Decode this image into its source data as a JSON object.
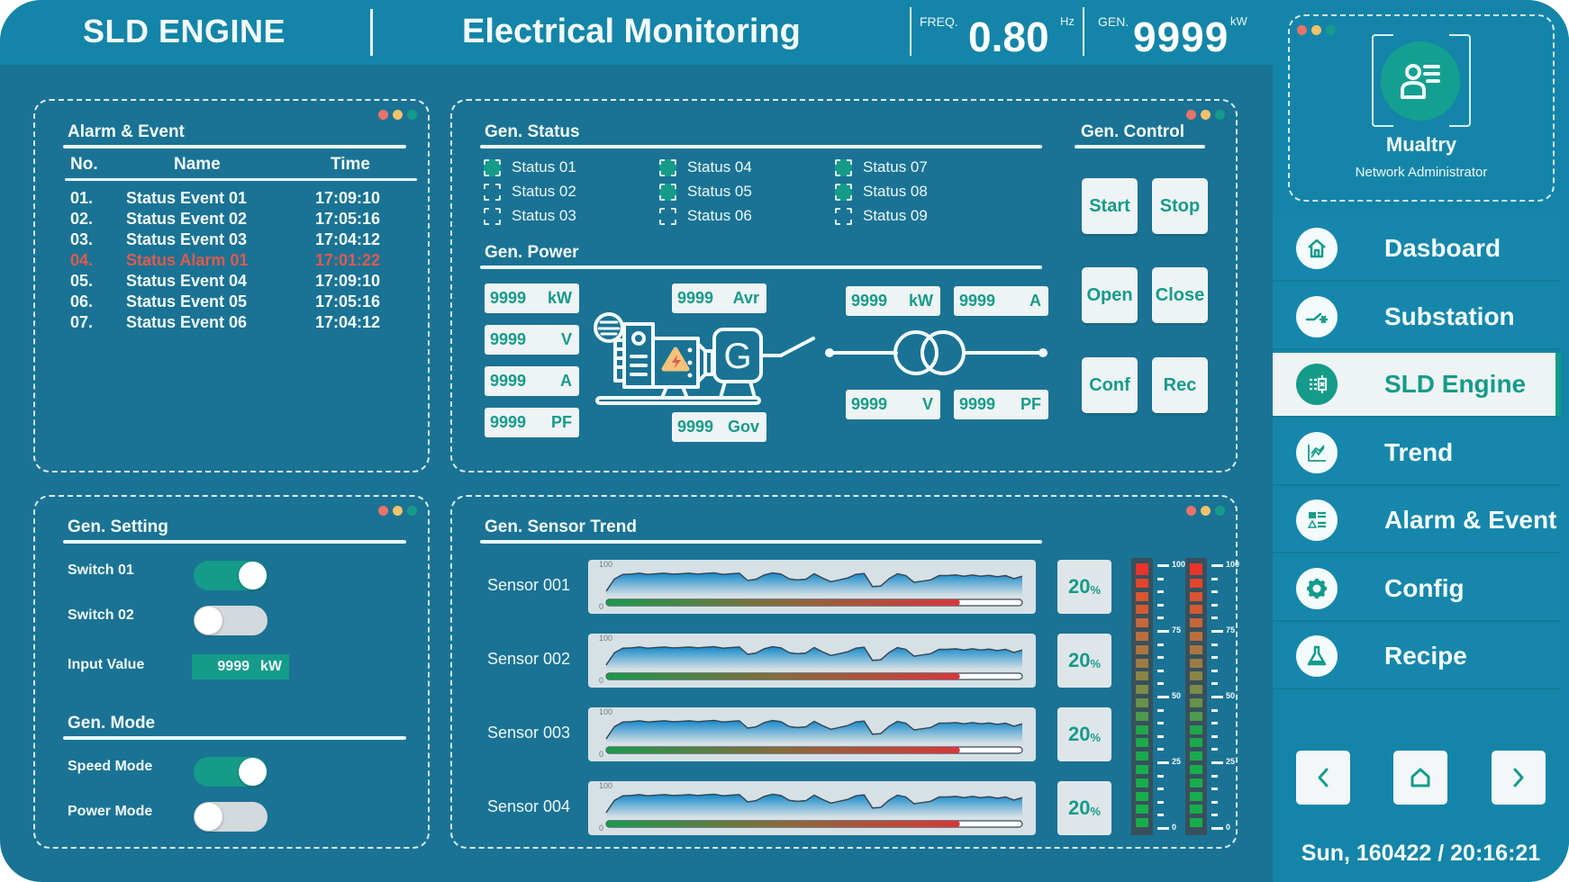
{
  "header": {
    "app_title": "SLD ENGINE",
    "page_title": "Electrical Monitoring",
    "freq_label": "FREQ.",
    "freq_value": "0.80",
    "freq_unit": "Hz",
    "gen_label": "GEN.",
    "gen_value": "9999",
    "gen_unit": "kW"
  },
  "alarm_event": {
    "title": "Alarm & Event",
    "columns": [
      "No.",
      "Name",
      "Time"
    ],
    "rows": [
      {
        "no": "01.",
        "name": "Status Event 01",
        "time": "17:09:10",
        "type": "event"
      },
      {
        "no": "02.",
        "name": "Status Event 02",
        "time": "17:05:16",
        "type": "event"
      },
      {
        "no": "03.",
        "name": "Status Event 03",
        "time": "17:04:12",
        "type": "event"
      },
      {
        "no": "04.",
        "name": "Status Alarm 01",
        "time": "17:01:22",
        "type": "alarm"
      },
      {
        "no": "05.",
        "name": "Status Event 04",
        "time": "17:09:10",
        "type": "event"
      },
      {
        "no": "06.",
        "name": "Status Event 05",
        "time": "17:05:16",
        "type": "event"
      },
      {
        "no": "07.",
        "name": "Status Event 06",
        "time": "17:04:12",
        "type": "event"
      }
    ]
  },
  "gen_status": {
    "title": "Gen. Status",
    "items": [
      {
        "label": "Status 01",
        "checked": true
      },
      {
        "label": "Status 02",
        "checked": false
      },
      {
        "label": "Status 03",
        "checked": false
      },
      {
        "label": "Status 04",
        "checked": true
      },
      {
        "label": "Status 05",
        "checked": true
      },
      {
        "label": "Status 06",
        "checked": false
      },
      {
        "label": "Status 07",
        "checked": true
      },
      {
        "label": "Status 08",
        "checked": true
      },
      {
        "label": "Status 09",
        "checked": false
      }
    ]
  },
  "gen_control": {
    "title": "Gen. Control",
    "buttons": [
      "Start",
      "Stop",
      "Open",
      "Close",
      "Conf",
      "Rec"
    ]
  },
  "gen_power": {
    "title": "Gen. Power",
    "left_values": [
      {
        "value": "9999",
        "unit": "kW"
      },
      {
        "value": "9999",
        "unit": "V"
      },
      {
        "value": "9999",
        "unit": "A"
      },
      {
        "value": "9999",
        "unit": "PF"
      }
    ],
    "avr": {
      "value": "9999",
      "unit": "Avr"
    },
    "gov": {
      "value": "9999",
      "unit": "Gov"
    },
    "right_top": [
      {
        "value": "9999",
        "unit": "kW"
      },
      {
        "value": "9999",
        "unit": "A"
      }
    ],
    "right_bottom": [
      {
        "value": "9999",
        "unit": "V"
      },
      {
        "value": "9999",
        "unit": "PF"
      }
    ],
    "generator_symbol": "G"
  },
  "gen_setting": {
    "title": "Gen. Setting",
    "switch1_label": "Switch 01",
    "switch1_on": true,
    "switch2_label": "Switch 02",
    "switch2_on": false,
    "input_label": "Input Value",
    "input_value": "9999",
    "input_unit": "kW"
  },
  "gen_mode": {
    "title": "Gen. Mode",
    "speed_label": "Speed Mode",
    "speed_on": true,
    "power_label": "Power Mode",
    "power_on": false
  },
  "sensor_trend": {
    "title": "Gen. Sensor Trend",
    "axis_max": "100",
    "axis_min": "0",
    "sensors": [
      {
        "name": "Sensor 001",
        "percent": "20",
        "bar_fill": 0.85
      },
      {
        "name": "Sensor 002",
        "percent": "20",
        "bar_fill": 0.85
      },
      {
        "name": "Sensor 003",
        "percent": "20",
        "bar_fill": 0.85
      },
      {
        "name": "Sensor 004",
        "percent": "20",
        "bar_fill": 0.85
      }
    ],
    "trend_values": [
      15,
      55,
      70,
      71,
      74,
      70,
      72,
      74,
      71,
      72,
      74,
      71,
      73,
      75,
      70,
      72,
      74,
      50,
      54,
      68,
      75,
      71,
      55,
      52,
      54,
      72,
      58,
      46,
      52,
      58,
      70,
      73,
      30,
      32,
      56,
      72,
      66,
      44,
      48,
      52,
      66,
      66,
      68,
      64,
      68,
      64,
      67,
      62,
      66,
      56,
      64
    ],
    "meter_scale": [
      "100",
      "75",
      "50",
      "25",
      "0"
    ]
  },
  "profile": {
    "name": "Mualtry",
    "role": "Network Administrator"
  },
  "nav": [
    {
      "label": "Dasboard",
      "icon": "home-icon",
      "active": false
    },
    {
      "label": "Substation",
      "icon": "switch-icon",
      "active": false
    },
    {
      "label": "SLD Engine",
      "icon": "sld-icon",
      "active": true
    },
    {
      "label": "Trend",
      "icon": "trend-chart-icon",
      "active": false
    },
    {
      "label": "Alarm & Event",
      "icon": "alarm-list-icon",
      "active": false
    },
    {
      "label": "Config",
      "icon": "gear-icon",
      "active": false
    },
    {
      "label": "Recipe",
      "icon": "flask-icon",
      "active": false
    }
  ],
  "footer": {
    "datetime": "Sun, 160422 / 20:16:21"
  },
  "colors": {
    "accent": "#159b8a",
    "alarm": "#e05a4f",
    "background": "#1a7394",
    "header": "#1485a8"
  }
}
